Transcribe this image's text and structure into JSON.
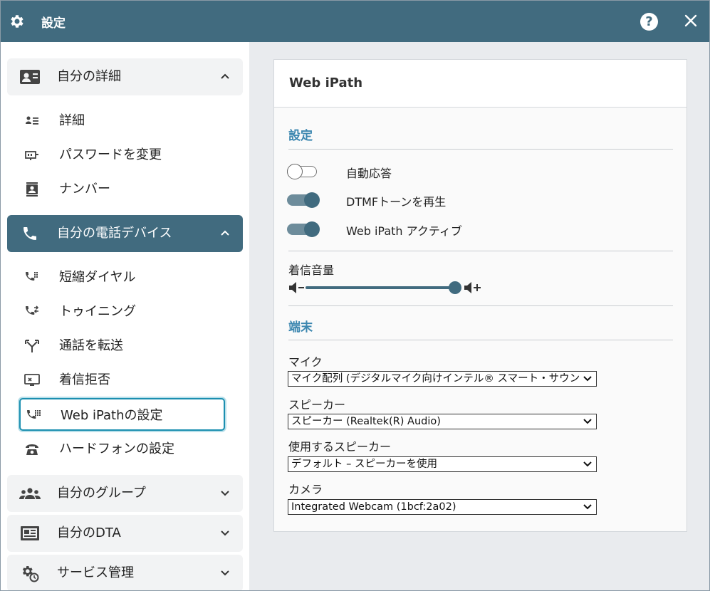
{
  "window": {
    "title": "設定"
  },
  "sidebar": {
    "groups": [
      {
        "label": "自分の詳細",
        "icon": "contact-card-icon",
        "expanded": true,
        "active": false
      },
      {
        "label": "自分の電話デバイス",
        "icon": "phone-icon",
        "expanded": true,
        "active": true
      },
      {
        "label": "自分のグループ",
        "icon": "group-icon",
        "expanded": false,
        "active": false
      },
      {
        "label": "自分のDTA",
        "icon": "dta-icon",
        "expanded": false,
        "active": false
      },
      {
        "label": "サービス管理",
        "icon": "service-settings-icon",
        "expanded": false,
        "active": false
      }
    ],
    "details_items": [
      {
        "label": "詳細",
        "icon": "details-list-icon"
      },
      {
        "label": "パスワードを変更",
        "icon": "password-icon"
      },
      {
        "label": "ナンバー",
        "icon": "number-badge-icon"
      }
    ],
    "device_items": [
      {
        "label": "短縮ダイヤル",
        "icon": "speed-dial-icon"
      },
      {
        "label": "トゥイニング",
        "icon": "twinning-icon"
      },
      {
        "label": "通話を転送",
        "icon": "call-forward-icon"
      },
      {
        "label": "着信拒否",
        "icon": "call-block-icon"
      },
      {
        "label": "Web iPathの設定",
        "icon": "web-ipath-settings-icon",
        "selected": true
      },
      {
        "label": "ハードフォンの設定",
        "icon": "hardphone-icon"
      }
    ]
  },
  "panel": {
    "title": "Web iPath",
    "settings_section": {
      "title": "設定",
      "toggles": [
        {
          "label": "自動応答",
          "on": false
        },
        {
          "label": "DTMFトーンを再生",
          "on": true
        },
        {
          "label": "Web iPath アクティブ",
          "on": true
        }
      ],
      "volume_label": "着信音量",
      "volume_level": 1.0
    },
    "device_section": {
      "title": "端末",
      "fields": [
        {
          "label": "マイク",
          "value": "マイク配列 (デジタルマイク向けインテル® スマート・サウンド・テクノロジー)"
        },
        {
          "label": "スピーカー",
          "value": "スピーカー (Realtek(R) Audio)"
        },
        {
          "label": "使用するスピーカー",
          "value": "デフォルト – スピーカーを使用"
        },
        {
          "label": "カメラ",
          "value": "Integrated Webcam (1bcf:2a02)"
        }
      ]
    }
  },
  "colors": {
    "header": "#416b7f",
    "accent": "#3c87b0",
    "selected_border": "#1c8fb0"
  }
}
